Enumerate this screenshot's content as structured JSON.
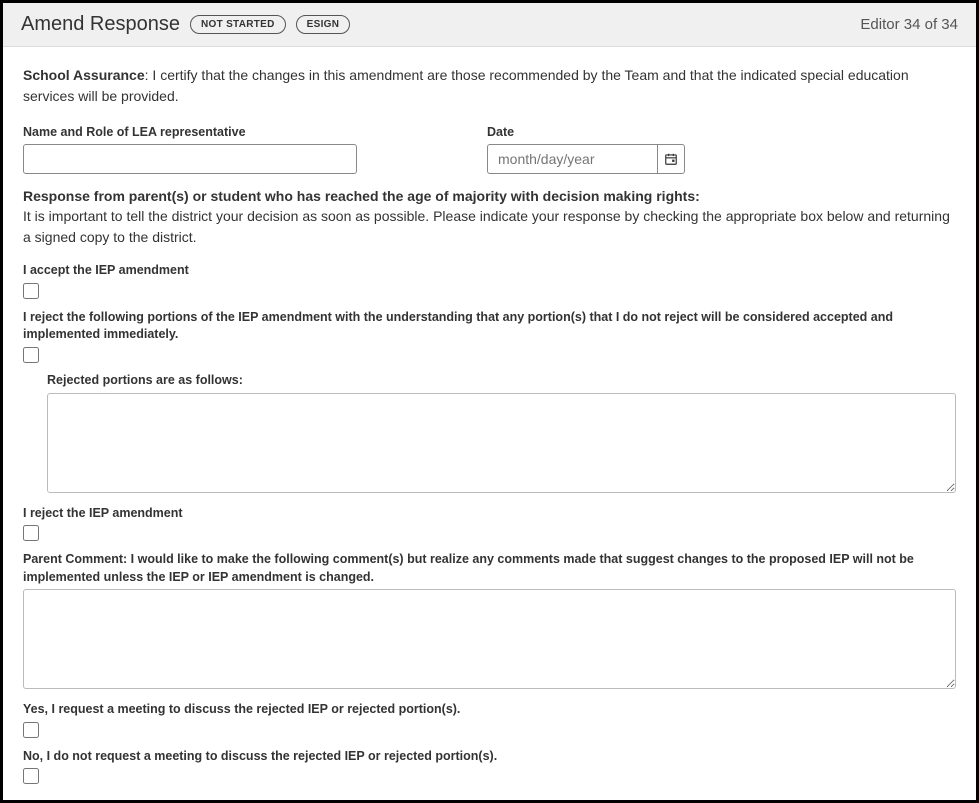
{
  "header": {
    "title": "Amend Response",
    "status_badge": "NOT STARTED",
    "esign_badge": "ESIGN",
    "editor_count": "Editor 34 of 34"
  },
  "assurance": {
    "label": "School Assurance",
    "text": ": I certify that the changes in this amendment are those recommended by the Team and that the indicated special education services will be provided."
  },
  "form": {
    "lea_label": "Name and Role of LEA representative",
    "lea_value": "",
    "date_label": "Date",
    "date_placeholder": "month/day/year"
  },
  "response": {
    "heading": "Response from parent(s) or student who has reached the age of majority with decision making rights:",
    "text": "It is important to tell the district your decision as soon as possible. Please indicate your response by checking the appropriate box below and returning a signed copy to the district."
  },
  "options": {
    "accept": "I accept the IEP amendment",
    "reject_portions": "I reject the following portions of the IEP amendment with the understanding that any portion(s) that I do not reject will be considered accepted and implemented immediately.",
    "rejected_portions_label": "Rejected portions are as follows:",
    "reject_full": "I reject the IEP amendment",
    "parent_comment": "Parent Comment: I would like to make the following comment(s) but realize any comments made that suggest changes to the proposed IEP will not be implemented unless the IEP or IEP amendment is changed.",
    "request_meeting_yes": "Yes, I request a meeting to discuss the rejected IEP or rejected portion(s).",
    "request_meeting_no": "No, I do not request a meeting to discuss the rejected IEP or rejected portion(s)."
  }
}
